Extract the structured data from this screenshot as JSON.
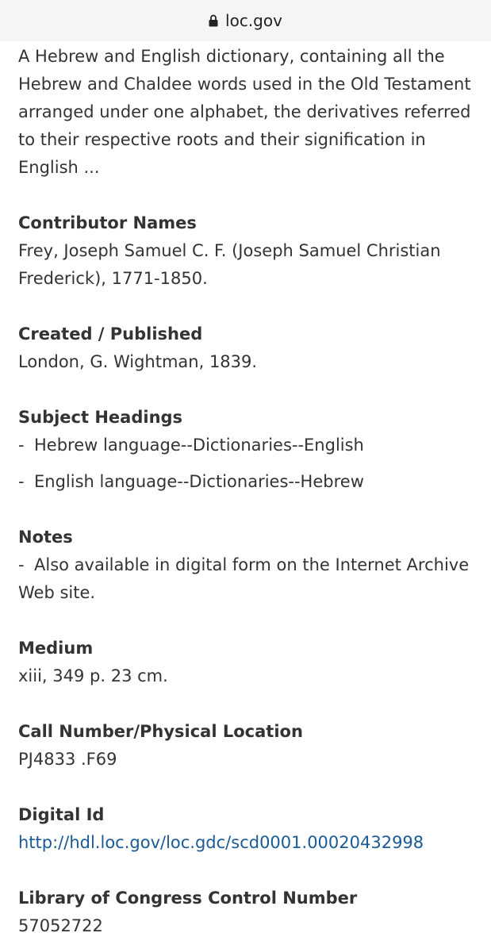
{
  "browser": {
    "url": "loc.gov",
    "lock_icon": "lock-icon"
  },
  "record": {
    "description": "A Hebrew and English dictionary, containing all the Hebrew and Chaldee words used in the Old Testament arranged under one alphabet, the derivatives referred to their respective roots and their signification in English ...",
    "contributor": {
      "label": "Contributor Names",
      "value": "Frey, Joseph Samuel C. F. (Joseph Samuel Christian Frederick), 1771-1850."
    },
    "created": {
      "label": "Created / Published",
      "value": "London, G. Wightman, 1839."
    },
    "subjects": {
      "label": "Subject Headings",
      "items": [
        "Hebrew language--Dictionaries--English",
        "English language--Dictionaries--Hebrew"
      ]
    },
    "notes": {
      "label": "Notes",
      "items": [
        "Also available in digital form on the Internet Archive Web site."
      ]
    },
    "medium": {
      "label": "Medium",
      "value": "xiii, 349 p. 23 cm."
    },
    "call_number": {
      "label": "Call Number/Physical Location",
      "value": "PJ4833 .F69"
    },
    "digital_id": {
      "label": "Digital Id",
      "value": "http://hdl.loc.gov/loc.gdc/scd0001.00020432998"
    },
    "lccn": {
      "label": "Library of Congress Control Number",
      "value": "57052722"
    }
  },
  "colors": {
    "link": "#1a5a96",
    "text": "#333333",
    "urlbar": "#f5f5f5"
  }
}
